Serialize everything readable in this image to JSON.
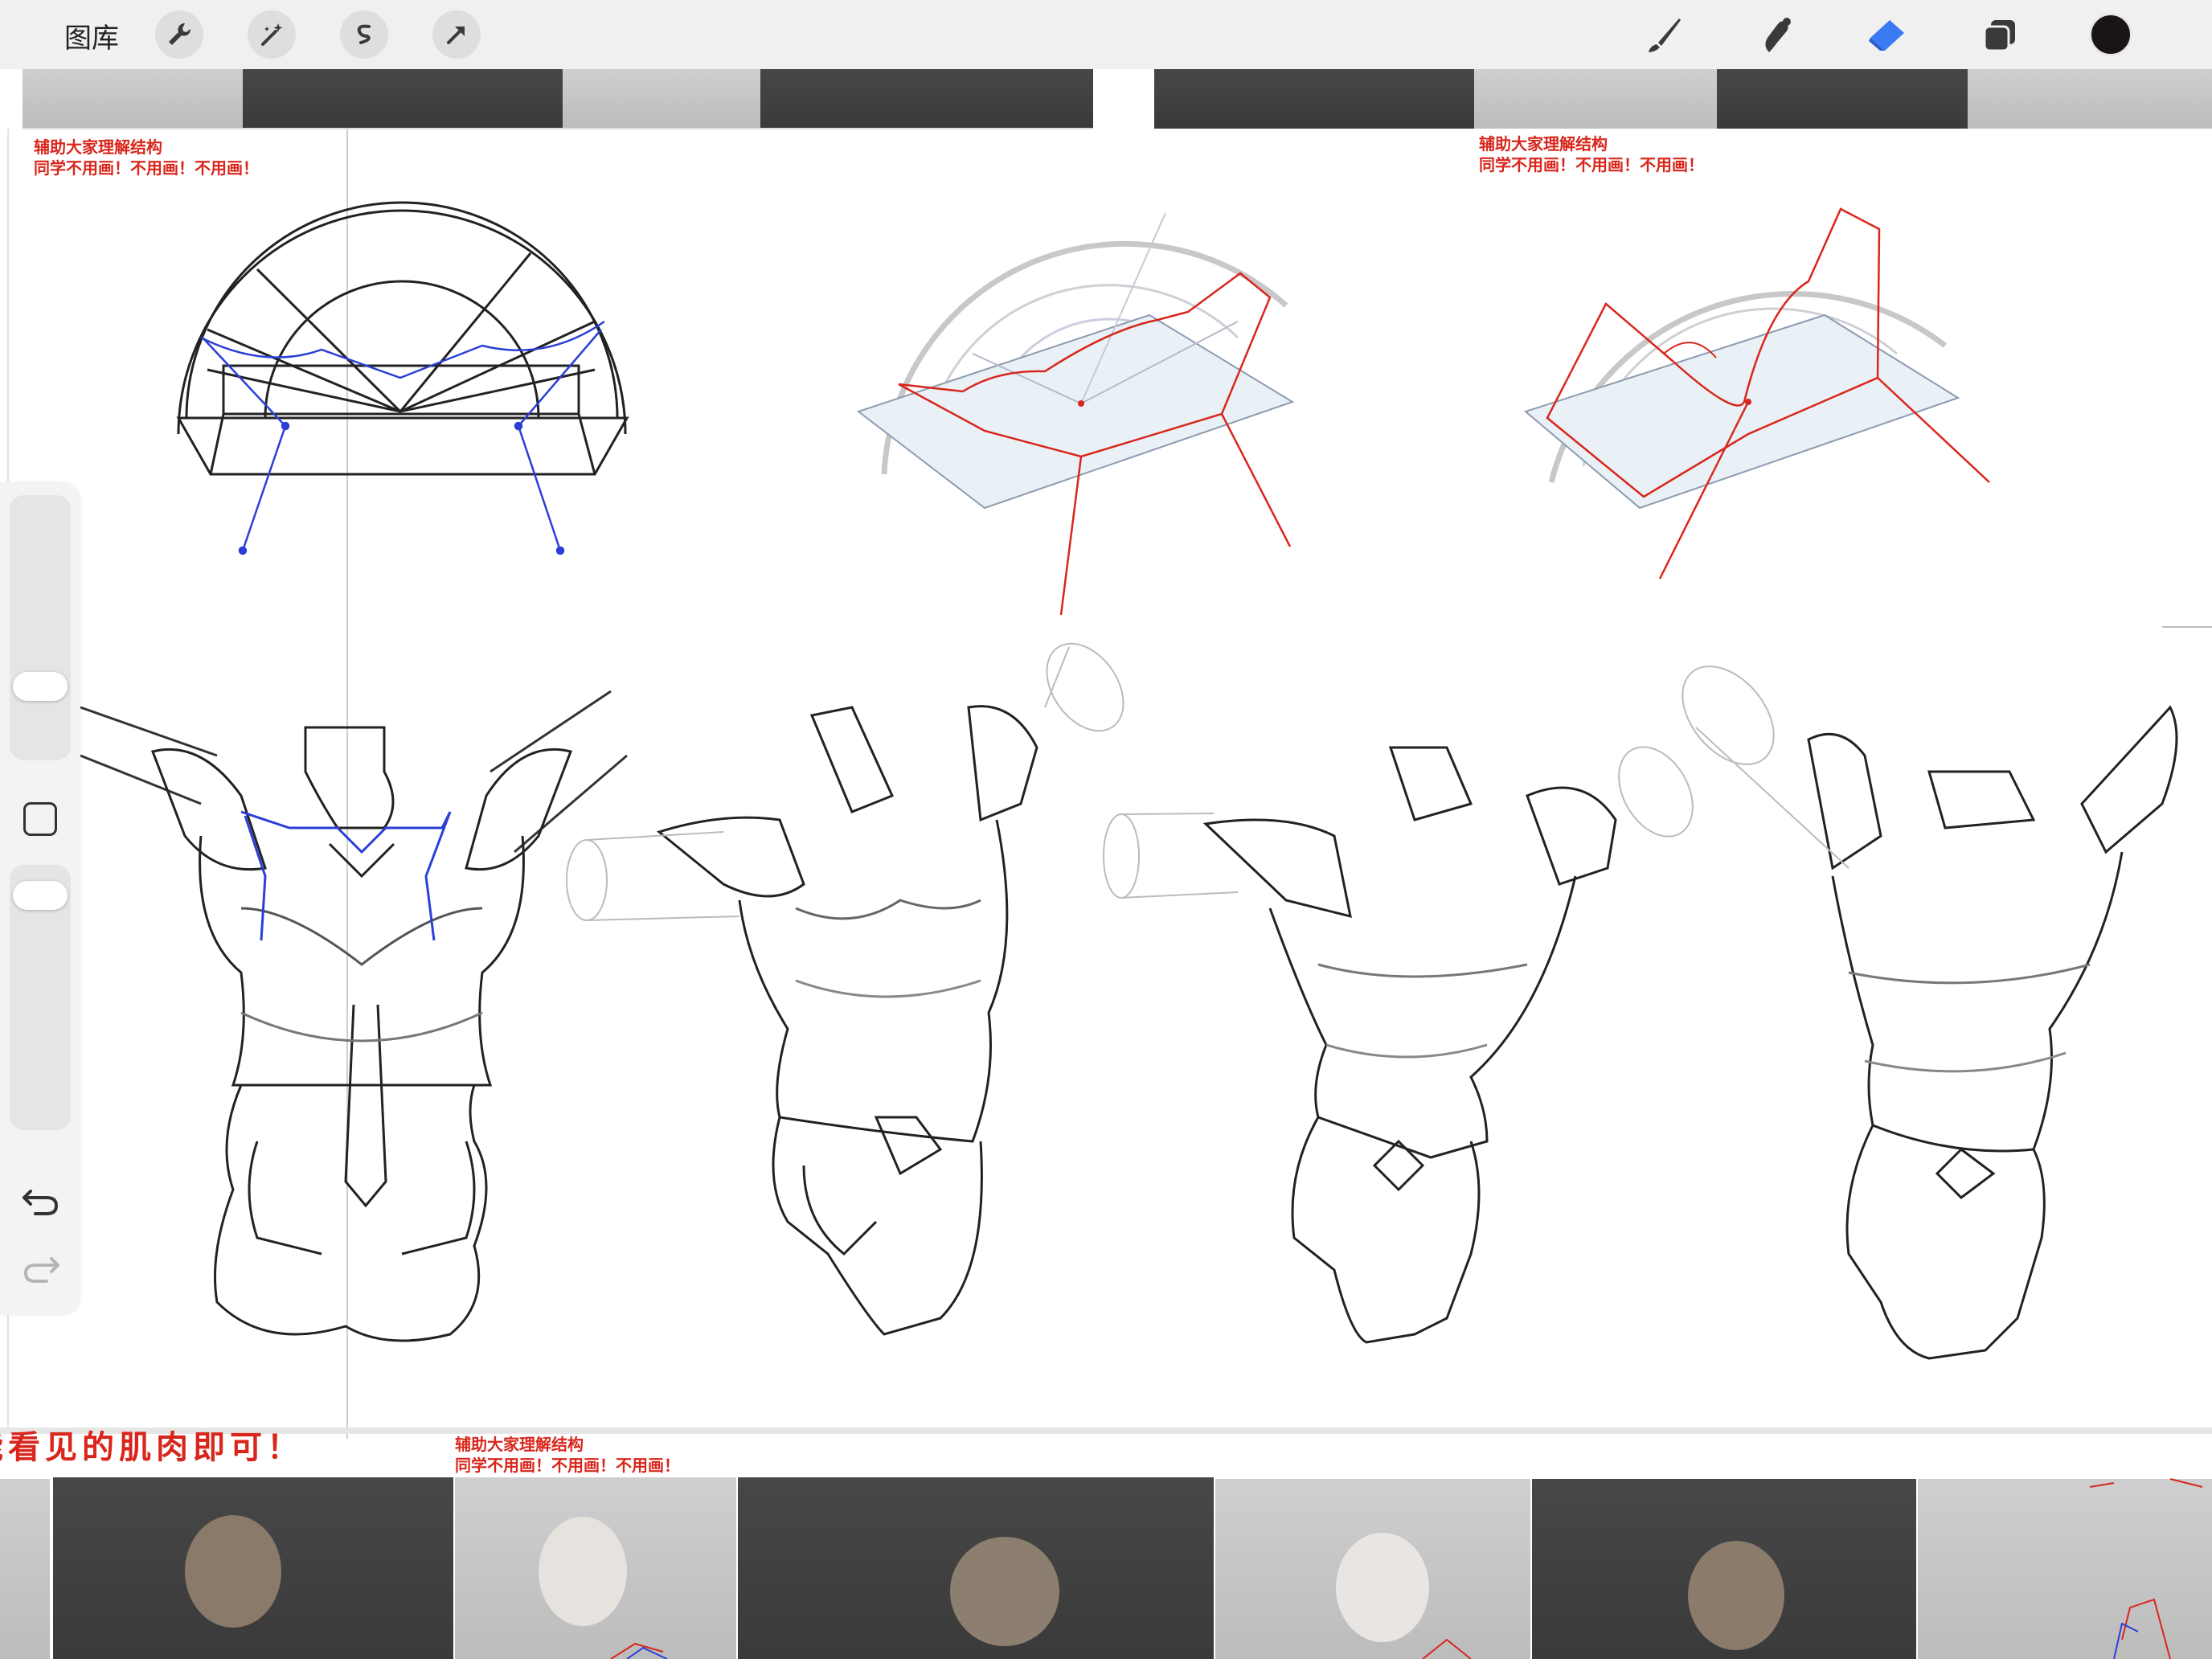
{
  "toolbar": {
    "gallery_label": "图库",
    "left_icons": [
      "wrench-icon",
      "magic-wand-icon",
      "selection-icon",
      "transform-arrow-icon"
    ],
    "right_icons": [
      "brush-icon",
      "smudge-icon",
      "eraser-icon",
      "layers-icon"
    ],
    "current_color": "#1a1414",
    "active_tool_color": "#3b7bf2"
  },
  "sidebar": {
    "icons": [
      "brush-size-slider",
      "modify-square-icon",
      "opacity-slider",
      "undo-icon",
      "redo-icon"
    ]
  },
  "canvas": {
    "annotations": {
      "top_left_line1": "辅助大家理解结构",
      "top_left_line2": "同学不用画！不用画！不用画！",
      "top_right_line1": "辅助大家理解结构",
      "top_right_line2": "同学不用画！不用画！不用画！",
      "bottom_mid_line1": "辅助大家理解结构",
      "bottom_mid_line2": "同学不用画！不用画！不用画！",
      "bottom_big": "能看见的肌肉即可！"
    },
    "colors": {
      "annotation_red": "#d9261c",
      "construction_blue": "#2b3fd6",
      "sketch_black": "#222222"
    }
  }
}
